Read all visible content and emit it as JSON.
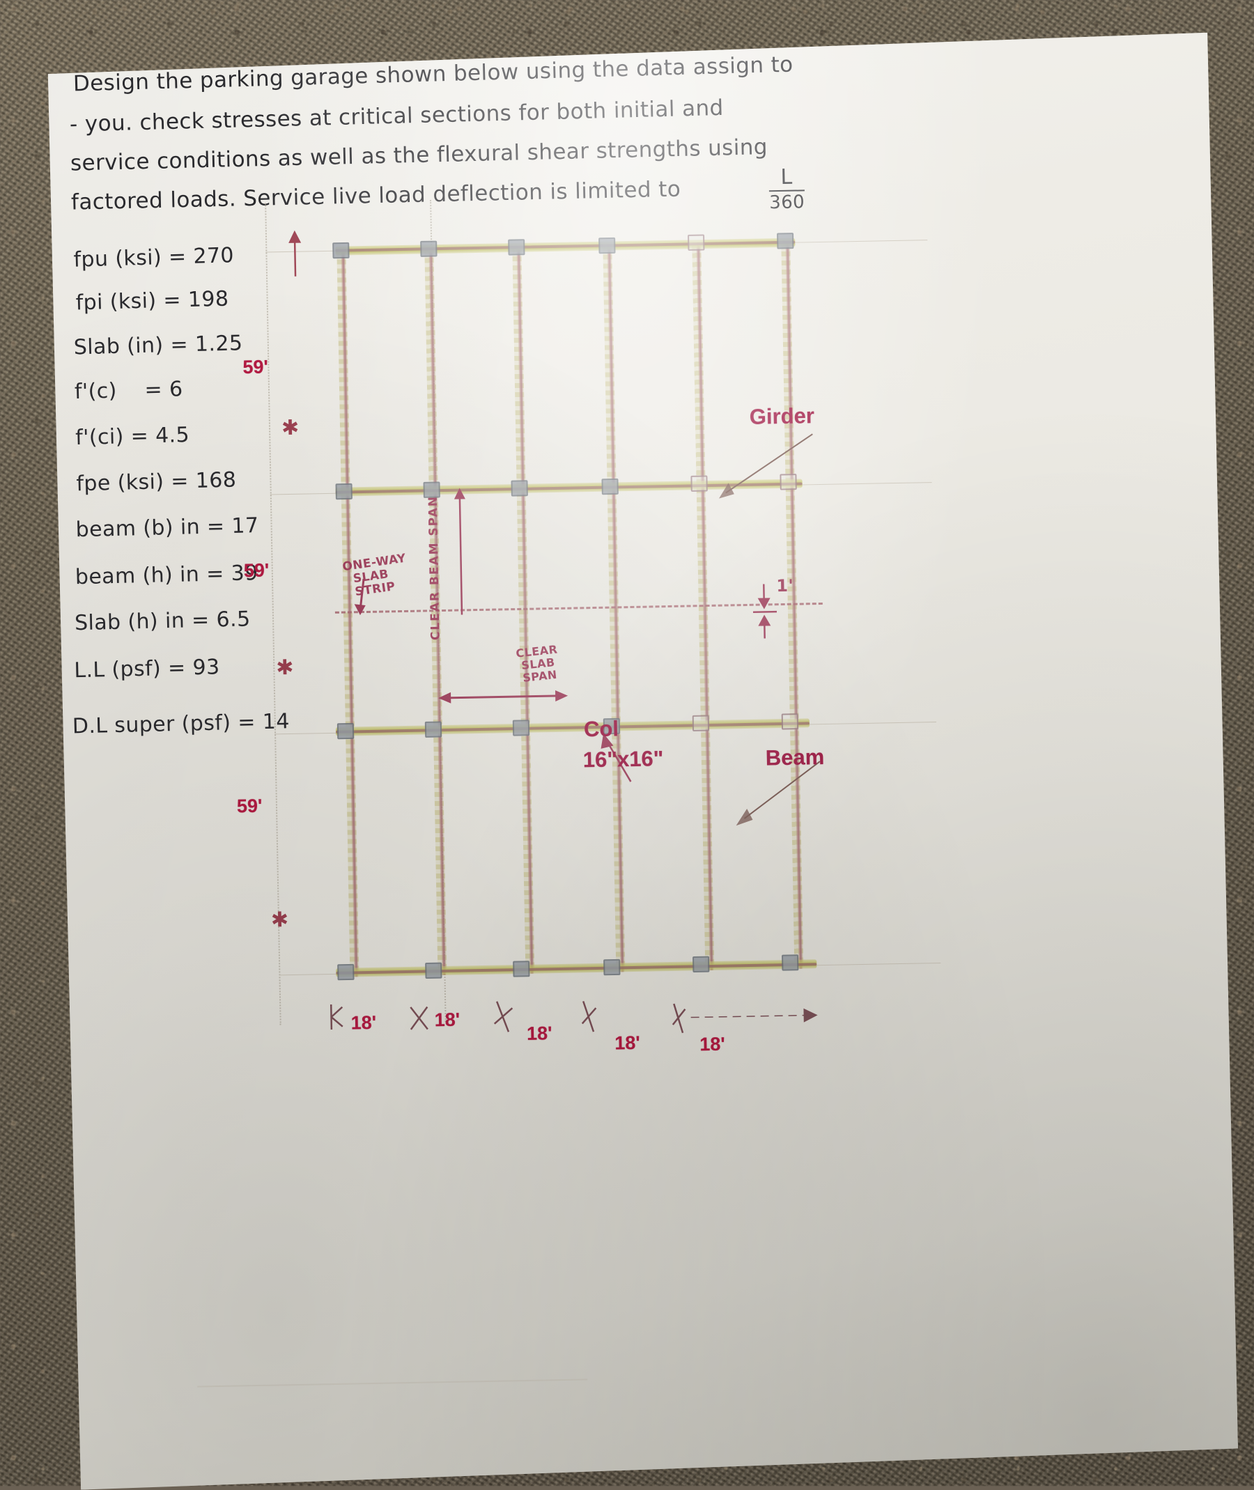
{
  "document": {
    "kind": "handwritten-assignment-photo",
    "prompt_lines": [
      "Design  the  parking  garage  shown  below  using  the  data  assign  to",
      "- you.  check  stresses  at  critical  sections  for  both  initial  and",
      "service  conditions  as  well  as  the  flexural  shear  strengths  using",
      "factored  loads.  Service  live  load  deflection  is  limited  to"
    ],
    "deflection_limit": {
      "numerator": "L",
      "denominator": "360"
    }
  },
  "given_data": [
    {
      "label": "fpu (ksi)",
      "eq": "=",
      "value": "270"
    },
    {
      "label": "fpi (ksi)",
      "eq": "=",
      "value": "198"
    },
    {
      "label": "Slab (in)",
      "eq": "=",
      "value": "1.25"
    },
    {
      "label": "f'(c)",
      "eq": "=",
      "value": "6"
    },
    {
      "label": "f'(ci)",
      "eq": "=",
      "value": "4.5"
    },
    {
      "label": "fpe (ksi)",
      "eq": "=",
      "value": "168"
    },
    {
      "label": "beam (b) in",
      "eq": "=",
      "value": "17"
    },
    {
      "label": "beam (h) in",
      "eq": "=",
      "value": "39"
    },
    {
      "label": "Slab (h) in",
      "eq": "=",
      "value": "6.5"
    },
    {
      "label": "L.L (psf)",
      "eq": "=",
      "value": "93"
    },
    {
      "label": "D.L super (psf)",
      "eq": "=",
      "value": "14"
    }
  ],
  "plan": {
    "printed_labels": [
      {
        "name": "girder",
        "text": "Girder"
      },
      {
        "name": "col",
        "text": "Col"
      },
      {
        "name": "col-size",
        "text": "16\"x16\""
      },
      {
        "name": "beam",
        "text": "Beam"
      }
    ],
    "vertical_dims": [
      "59'",
      "59'",
      "59'"
    ],
    "horizontal_dims": [
      "18'",
      "18'",
      "18'",
      "18'",
      "18'"
    ],
    "handwritten_notes": [
      {
        "name": "one-way-slab-strip",
        "text": "ONE-WAY\n  SLAB\n  STRIP"
      },
      {
        "name": "clear-beam-span",
        "text": "CLEAR BEAM SPAN"
      },
      {
        "name": "clear-slab-span",
        "text": "CLEAR\n SLAB\n SPAN"
      },
      {
        "name": "one-foot",
        "text": "1'"
      }
    ],
    "grid": {
      "columns": 6,
      "rows": 4,
      "bay_width_ft": 18,
      "bay_depth_ft": 59
    }
  },
  "colors": {
    "printed_label": "#b0174a",
    "handwritten_pink": "#9e3a58",
    "highlighter": "#c5c56a",
    "pencil_red": "#b9767f",
    "ink": "#2b2b2f",
    "paper": "#eeece6"
  }
}
